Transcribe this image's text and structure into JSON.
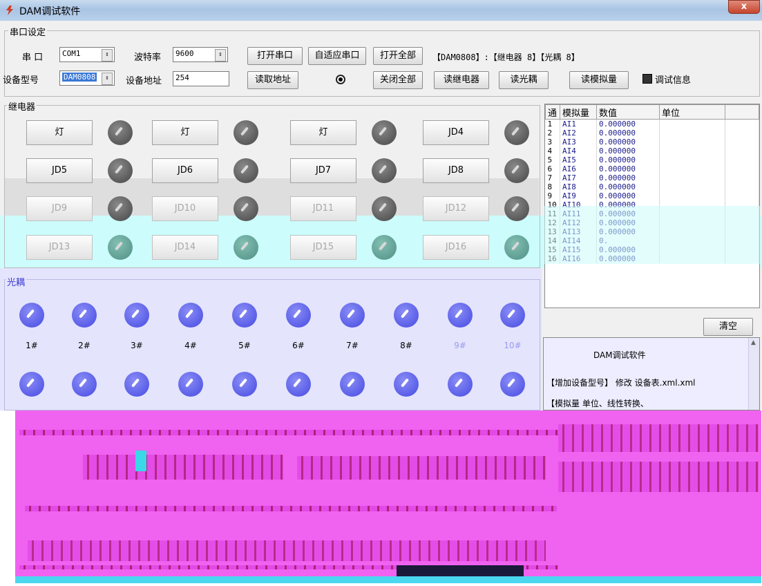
{
  "window": {
    "title": "DAM调试软件",
    "close": "x"
  },
  "serial": {
    "group_label": "串口设定",
    "port_label": "串 口",
    "port_value": "COM1",
    "baud_label": "波特率",
    "baud_value": "9600",
    "model_label": "设备型号",
    "model_value": "DAM0808",
    "address_label": "设备地址",
    "address_value": "254",
    "open_port": "打开串口",
    "auto_port": "自适应串口",
    "open_all": "打开全部",
    "read_address": "读取地址",
    "close_all": "关闭全部",
    "read_relay": "读继电器",
    "read_optocoupler": "读光耦",
    "read_analog": "读模拟量",
    "debug_info": "调试信息",
    "device_info": "【DAM0808】:【继电器 8】【光耦 8】"
  },
  "relay": {
    "group_label": "继电器",
    "buttons": [
      "灯",
      "灯",
      "灯",
      "JD4",
      "JD5",
      "JD6",
      "JD7",
      "JD8",
      "JD9",
      "JD10",
      "JD11",
      "JD12",
      "JD13",
      "JD14",
      "JD15",
      "JD16"
    ]
  },
  "optocoupler": {
    "group_label": "光耦",
    "labels": [
      "1#",
      "2#",
      "3#",
      "4#",
      "5#",
      "6#",
      "7#",
      "8#",
      "9#",
      "10#"
    ]
  },
  "analog": {
    "headers": [
      "通",
      "模拟量",
      "数值",
      "单位"
    ],
    "rows": [
      [
        "1",
        "AI1",
        "0.000000"
      ],
      [
        "2",
        "AI2",
        "0.000000"
      ],
      [
        "3",
        "AI3",
        "0.000000"
      ],
      [
        "4",
        "AI4",
        "0.000000"
      ],
      [
        "5",
        "AI5",
        "0.000000"
      ],
      [
        "6",
        "AI6",
        "0.000000"
      ],
      [
        "7",
        "AI7",
        "0.000000"
      ],
      [
        "8",
        "AI8",
        "0.000000"
      ],
      [
        "9",
        "AI9",
        "0.000000"
      ],
      [
        "10",
        "AI10",
        "0.000000"
      ],
      [
        "11",
        "AI11",
        "0.000000"
      ],
      [
        "12",
        "AI12",
        "0.000000"
      ],
      [
        "13",
        "AI13",
        "0.000000"
      ],
      [
        "14",
        "AI14",
        "0."
      ],
      [
        "15",
        "AI15",
        "0.000000"
      ],
      [
        "16",
        "AI16",
        "0.000000"
      ]
    ],
    "clear": "清空"
  },
  "log": {
    "title": "DAM调试软件",
    "line1": "【增加设备型号】 修改  设备表.xml.xml",
    "line2": "【模拟量 单位、线性转换、"
  }
}
